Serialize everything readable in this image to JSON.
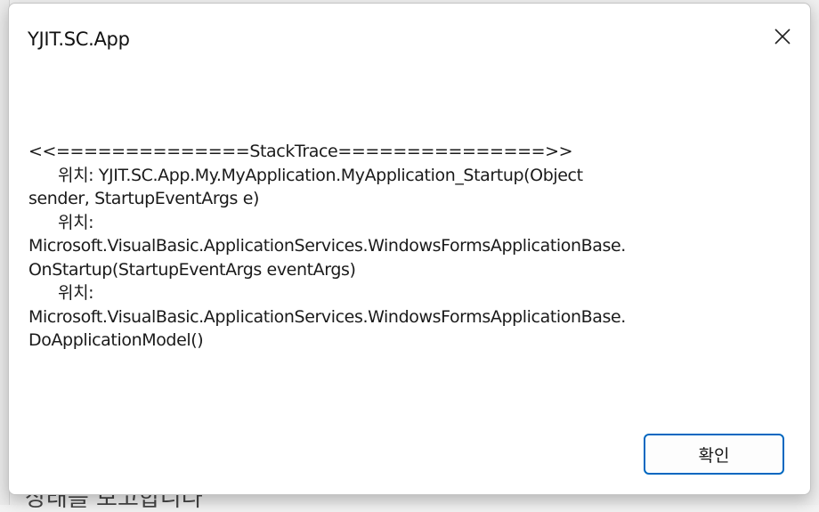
{
  "dialog": {
    "title": "YJIT.SC.App",
    "close_icon": "close-icon",
    "message_lines": [
      "<<==============StackTrace===============>>",
      "위치: YJIT.SC.App.My.MyApplication.MyApplication_Startup(Object",
      "sender, StartupEventArgs e)",
      "위치:",
      "Microsoft.VisualBasic.ApplicationServices.WindowsFormsApplicationBase.",
      "OnStartup(StartupEventArgs eventArgs)",
      "위치:",
      "Microsoft.VisualBasic.ApplicationServices.WindowsFormsApplicationBase.",
      "DoApplicationModel()"
    ],
    "ok_label": "확인"
  },
  "background": {
    "partial_text": "상태를 보고합니다"
  },
  "colors": {
    "accent": "#0067c0",
    "dialog_bg": "#ffffff",
    "text": "#1a1a1a"
  }
}
